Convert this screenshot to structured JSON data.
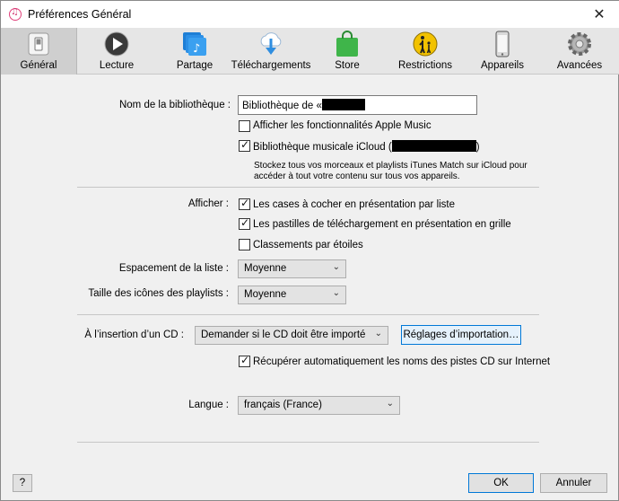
{
  "window": {
    "title": "Préférences Général",
    "close_glyph": "✕"
  },
  "toolbar": [
    {
      "label": "Général",
      "icon": "general-switch-icon"
    },
    {
      "label": "Lecture",
      "icon": "play-icon"
    },
    {
      "label": "Partage",
      "icon": "sharing-icon"
    },
    {
      "label": "Téléchargements",
      "icon": "cloud-download-icon"
    },
    {
      "label": "Store",
      "icon": "store-bag-icon"
    },
    {
      "label": "Restrictions",
      "icon": "parental-restrictions-icon"
    },
    {
      "label": "Appareils",
      "icon": "device-icon"
    },
    {
      "label": "Avancées",
      "icon": "gear-icon"
    }
  ],
  "library": {
    "label": "Nom de la bibliothèque :",
    "value": "Bibliothèque de «",
    "show_apple_music": {
      "label": "Afficher les fonctionnalités Apple Music",
      "checked": false
    },
    "icloud_library": {
      "label": "Bibliothèque musicale iCloud (",
      "label_end": ")",
      "checked": true
    },
    "icloud_desc_1": "Stockez tous vos morceaux et playlists iTunes Match sur iCloud pour",
    "icloud_desc_2": "accéder à tout votre contenu sur tous vos appareils."
  },
  "display": {
    "label": "Afficher :",
    "list_checkboxes": {
      "label": "Les cases à cocher en présentation par liste",
      "checked": true
    },
    "grid_badges": {
      "label": "Les pastilles de téléchargement en présentation en grille",
      "checked": true
    },
    "star_ratings": {
      "label": "Classements par étoiles",
      "checked": false
    },
    "list_spacing": {
      "label": "Espacement de la liste :",
      "value": "Moyenne"
    },
    "playlist_icon_size": {
      "label": "Taille des icônes des playlists :",
      "value": "Moyenne"
    }
  },
  "cd": {
    "label": "À l’insertion d’un CD :",
    "value": "Demander si le CD doit être importé",
    "import_settings": "Réglages d’importation…",
    "fetch_names": {
      "label": "Récupérer automatiquement les noms des pistes CD sur Internet",
      "checked": true
    }
  },
  "language": {
    "label": "Langue :",
    "value": "français (France)"
  },
  "footer": {
    "help": "?",
    "ok": "OK",
    "cancel": "Annuler"
  },
  "checkmark": "✓",
  "chevron": "⌄"
}
